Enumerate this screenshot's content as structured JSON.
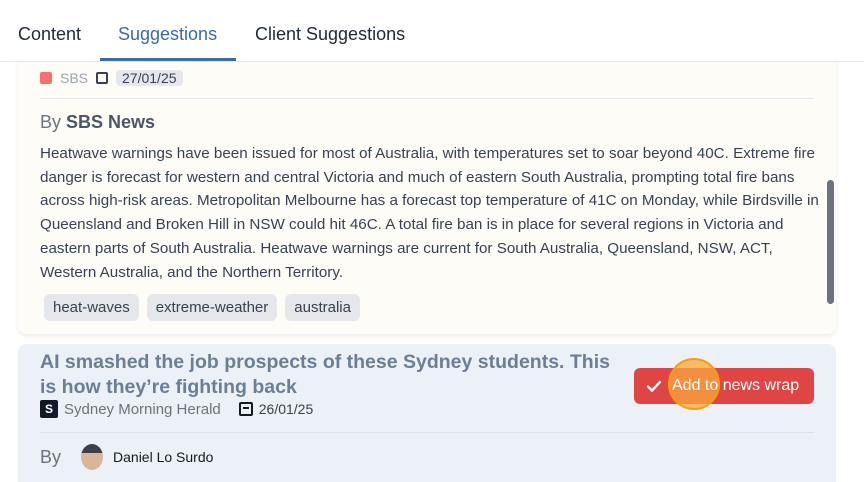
{
  "tabs": [
    {
      "label": "Content",
      "active": false
    },
    {
      "label": "Suggestions",
      "active": true
    },
    {
      "label": "Client Suggestions",
      "active": false
    }
  ],
  "card1": {
    "source_clipped": "SBS",
    "date_clipped": "27/01/25",
    "by_label": "By",
    "author": "SBS News",
    "body": "Heatwave warnings have been issued for most of Australia, with temperatures set to soar beyond 40C. Extreme fire danger is forecast for western and central Victoria and much of eastern South Australia, prompting total fire bans across high-risk areas. Metropolitan Melbourne has a forecast top temperature of 41C on Monday, while Birdsville in Queensland and Broken Hill in NSW could hit 46C. A total fire ban is in place for several regions in Victoria and eastern parts of South Australia. Heatwave warnings are current for South Australia, Queensland, NSW, ACT, Western Australia, and the Northern Territory.",
    "tags": [
      "heat-waves",
      "extreme-weather",
      "australia"
    ]
  },
  "card2": {
    "title": "AI smashed the job prospects of these Sydney students. This is how they’re fighting back",
    "source": "Sydney Morning Herald",
    "source_logo_letter": "S",
    "date": "26/01/25",
    "by_label": "By",
    "author": "Daniel Lo Surdo",
    "add_button_label": "Add to news wrap"
  },
  "colors": {
    "accent": "#3b6aa8",
    "add_button": "#e04545",
    "card2_bg": "#ecf0f7"
  }
}
